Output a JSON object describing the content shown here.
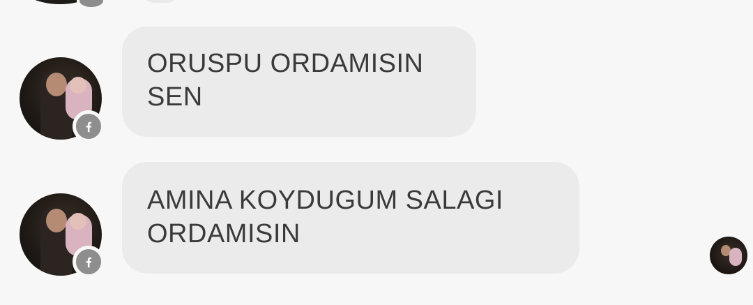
{
  "messages": [
    {
      "text": "ORUSPU ORDAMISIN\nSEN"
    },
    {
      "text": "AMINA KOYDUGUM  SALAGI\nORDAMISIN"
    }
  ],
  "icons": {
    "avatar": "profile-photo",
    "platform_badge": "facebook-icon",
    "read_receipt": "seen-avatar"
  },
  "colors": {
    "background": "#f7f7f7",
    "bubble": "#ebebeb",
    "text": "#3a3a3a",
    "badge": "#8e8e8e"
  }
}
